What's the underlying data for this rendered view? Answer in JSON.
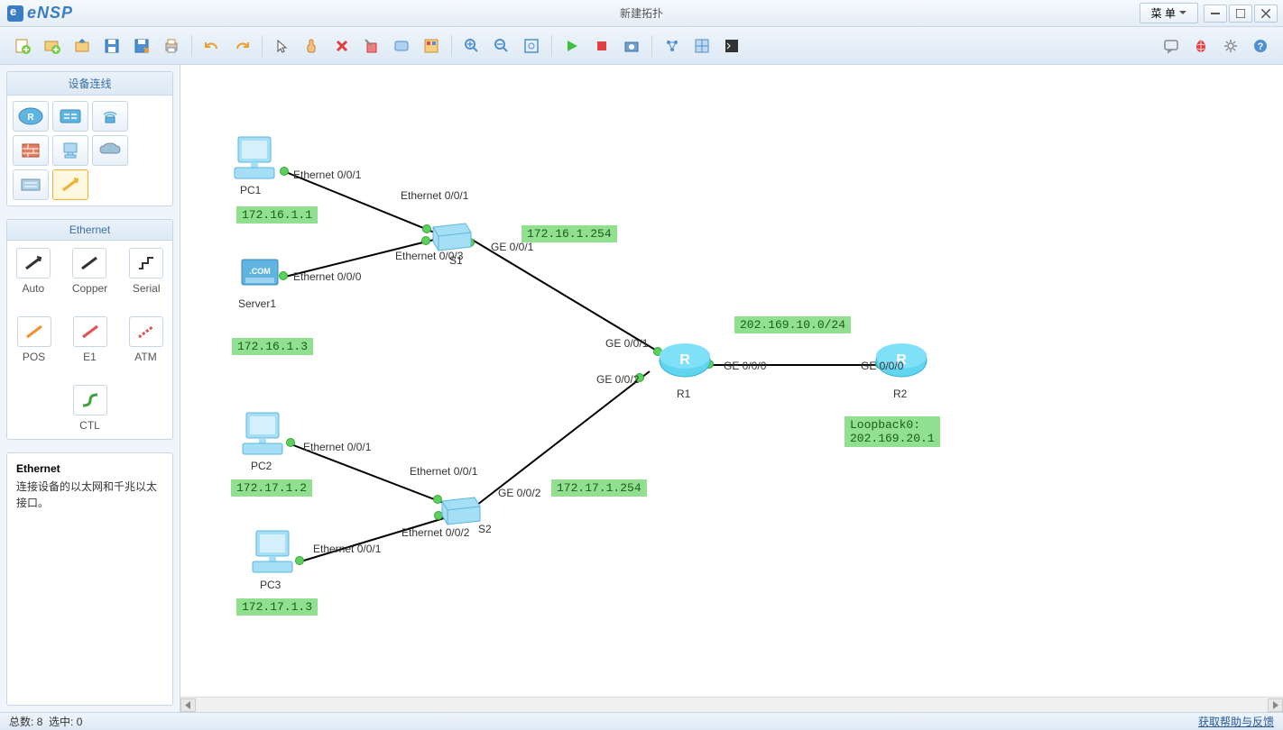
{
  "app": {
    "name": "eNSP",
    "title": "新建拓扑"
  },
  "menu": {
    "label": "菜 单"
  },
  "sidebar": {
    "device_header": "设备连线",
    "conn_header": "Ethernet",
    "connections": [
      {
        "label": "Auto"
      },
      {
        "label": "Copper"
      },
      {
        "label": "Serial"
      },
      {
        "label": "POS"
      },
      {
        "label": "E1"
      },
      {
        "label": "ATM"
      },
      {
        "label": "CTL"
      }
    ],
    "info_title": "Ethernet",
    "info_text": "连接设备的以太网和千兆以太接口。"
  },
  "topology": {
    "nodes": {
      "pc1": {
        "label": "PC1",
        "ip": "172.16.1.1"
      },
      "server1": {
        "label": "Server1",
        "ip": "172.16.1.3"
      },
      "pc2": {
        "label": "PC2",
        "ip": "172.17.1.2"
      },
      "pc3": {
        "label": "PC3",
        "ip": "172.17.1.3"
      },
      "s1": {
        "label": "S1",
        "gw": "172.16.1.254"
      },
      "s2": {
        "label": "S2",
        "gw": "172.17.1.254"
      },
      "r1": {
        "label": "R1"
      },
      "r2": {
        "label": "R2",
        "loop": "Loopback0:\n202.169.20.1"
      }
    },
    "wan": "202.169.10.0/24",
    "ports": {
      "pc1_e": "Ethernet 0/0/1",
      "s1_e1": "Ethernet 0/0/1",
      "s1_e3": "Ethernet 0/0/3",
      "srv_e0": "Ethernet 0/0/0",
      "s1_g1": "GE 0/0/1",
      "r1_g1": "GE 0/0/1",
      "r1_g2": "GE 0/0/2",
      "r1_g0": "GE 0/0/0",
      "r2_g0": "GE 0/0/0",
      "pc2_e": "Ethernet 0/0/1",
      "s2_e1": "Ethernet 0/0/1",
      "s2_e2": "Ethernet 0/0/2",
      "pc3_e": "Ethernet 0/0/1",
      "s2_g2": "GE 0/0/2"
    }
  },
  "status": {
    "total_label": "总数:",
    "total": "8",
    "sel_label": "选中:",
    "sel": "0",
    "help": "获取帮助与反馈"
  }
}
